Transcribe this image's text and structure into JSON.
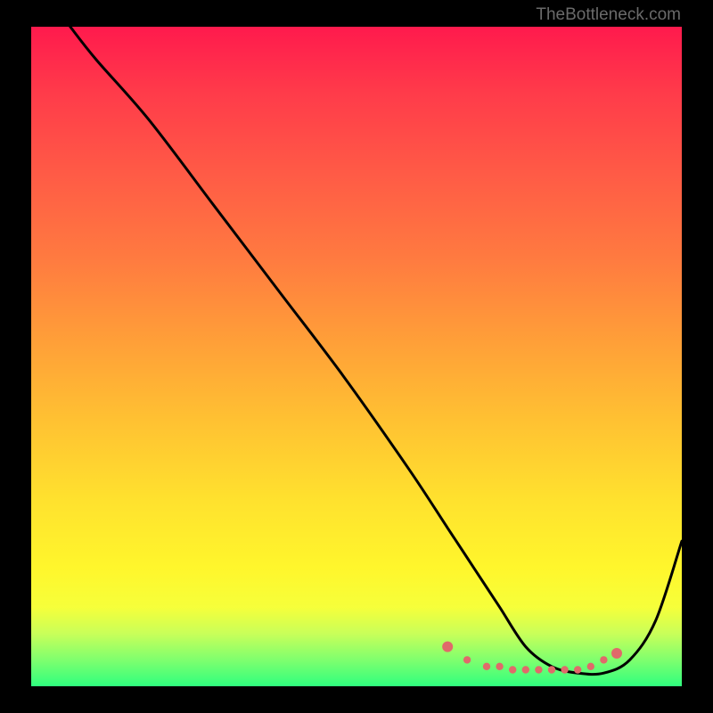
{
  "attribution": "TheBottleneck.com",
  "chart_data": {
    "type": "line",
    "title": "",
    "xlabel": "",
    "ylabel": "",
    "ylim": [
      0,
      100
    ],
    "xlim": [
      0,
      100
    ],
    "series": [
      {
        "name": "bottleneck-curve",
        "x": [
          6,
          10,
          18,
          28,
          38,
          48,
          58,
          64,
          68,
          72,
          76,
          80,
          84,
          88,
          92,
          96,
          100
        ],
        "y": [
          100,
          95,
          86,
          73,
          60,
          47,
          33,
          24,
          18,
          12,
          6,
          3,
          2,
          2,
          4,
          10,
          22
        ]
      }
    ],
    "markers": {
      "name": "flat-region-dots",
      "color": "#e06a6a",
      "x": [
        64,
        67,
        70,
        72,
        74,
        76,
        78,
        80,
        82,
        84,
        86,
        88,
        90
      ],
      "y": [
        6,
        4,
        3,
        3,
        2.5,
        2.5,
        2.5,
        2.5,
        2.5,
        2.5,
        3,
        4,
        5
      ]
    }
  }
}
